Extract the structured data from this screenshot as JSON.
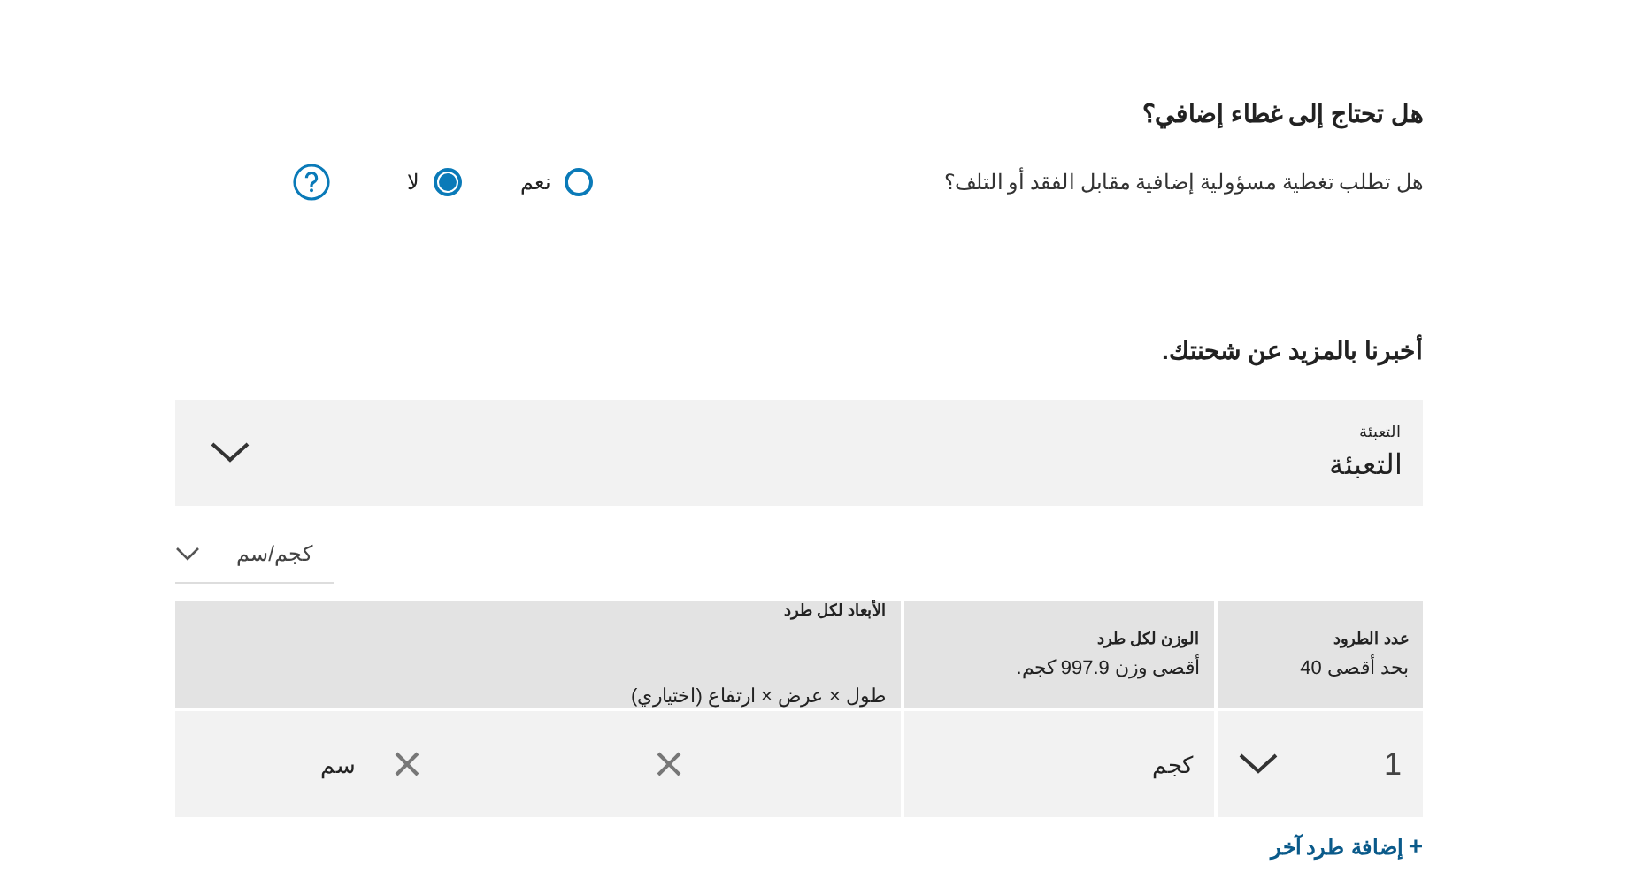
{
  "coverage": {
    "title": "هل تحتاج إلى غطاء إضافي؟",
    "question": "هل تطلب تغطية مسؤولية إضافية مقابل الفقد أو التلف؟",
    "options": [
      {
        "label": "نعم",
        "selected": false
      },
      {
        "label": "لا",
        "selected": true
      }
    ]
  },
  "shipment": {
    "title": "أخبرنا بالمزيد عن شحنتك.",
    "packaging": {
      "label": "التعبئة",
      "value": "التعبئة"
    },
    "units": {
      "value": "كجم/سم"
    },
    "table": {
      "columns": [
        {
          "title": "عدد الطرود",
          "hint": "بحد أقصى 40"
        },
        {
          "title": "الوزن لكل طرد",
          "hint": "أقصى وزن 997.9 كجم."
        },
        {
          "title": "الأبعاد لكل طرد",
          "hint": "طول × عرض × ارتفاع (اختياري)"
        }
      ],
      "rows": [
        {
          "count": "1",
          "weight_unit": "كجم",
          "dims_unit": "سم"
        }
      ]
    },
    "add_link": "إضافة طرد آخر",
    "add_icon": "+"
  }
}
